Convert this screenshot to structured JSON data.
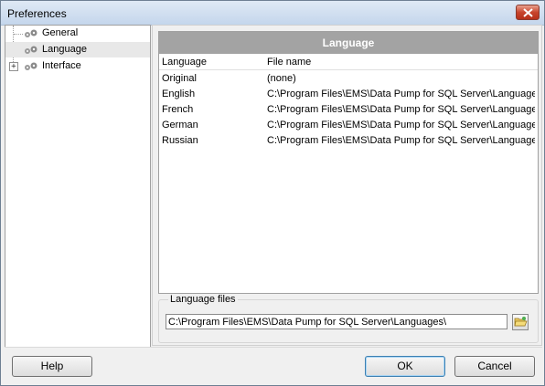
{
  "window": {
    "title": "Preferences"
  },
  "tree": {
    "items": [
      {
        "label": "General",
        "icon": "gears-icon",
        "expandable": false
      },
      {
        "label": "Language",
        "icon": "gears-icon",
        "expandable": false,
        "selected": true
      },
      {
        "label": "Interface",
        "icon": "gears-icon",
        "expandable": true,
        "expander": "+"
      }
    ]
  },
  "language_panel": {
    "header": "Language",
    "columns": [
      "Language",
      "File name"
    ],
    "rows": [
      {
        "language": "Original",
        "file": "(none)"
      },
      {
        "language": "English",
        "file": "C:\\Program Files\\EMS\\Data Pump for SQL Server\\Languages\\"
      },
      {
        "language": "French",
        "file": "C:\\Program Files\\EMS\\Data Pump for SQL Server\\Languages\\"
      },
      {
        "language": "German",
        "file": "C:\\Program Files\\EMS\\Data Pump for SQL Server\\Languages\\"
      },
      {
        "language": "Russian",
        "file": "C:\\Program Files\\EMS\\Data Pump for SQL Server\\Languages\\"
      }
    ]
  },
  "language_files": {
    "legend": "Language files",
    "path": "C:\\Program Files\\EMS\\Data Pump for SQL Server\\Languages\\"
  },
  "buttons": {
    "help": "Help",
    "ok": "OK",
    "cancel": "Cancel"
  },
  "colors": {
    "panel_header_bg": "#a3a3a3",
    "panel_header_text": "#ffffff",
    "close_button": "#c8452d"
  }
}
